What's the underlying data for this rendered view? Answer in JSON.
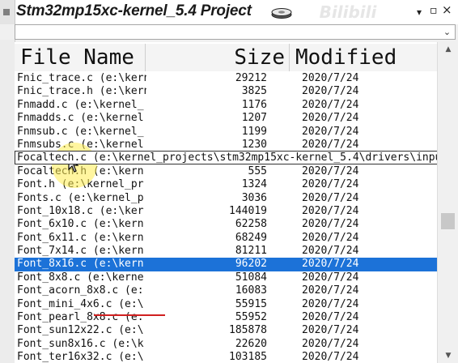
{
  "window": {
    "title": "Stm32mp15xc-kernel_5.4 Project",
    "watermark": "Bilibili"
  },
  "titlebar_icons": {
    "pin": "▾",
    "close": "×"
  },
  "combo": {
    "value": "",
    "arrow": "⌄"
  },
  "columns": {
    "name": "File Name",
    "size": "Size",
    "modified": "Modified"
  },
  "expanded_row_text": "Focaltech.c (e:\\kernel_projects\\stm32mp15xc-kernel_5.4\\drivers\\input",
  "rows": [
    {
      "name": "Fnic_trace.c (e:\\kern",
      "size": "29212",
      "modified": "2020/7/24"
    },
    {
      "name": "Fnic_trace.h (e:\\kern",
      "size": "3825",
      "modified": "2020/7/24"
    },
    {
      "name": "Fnmadd.c (e:\\kernel_",
      "size": "1176",
      "modified": "2020/7/24"
    },
    {
      "name": "Fnmadds.c (e:\\kernel",
      "size": "1207",
      "modified": "2020/7/24"
    },
    {
      "name": "Fnmsub.c (e:\\kernel_",
      "size": "1199",
      "modified": "2020/7/24"
    },
    {
      "name": "Fnmsubs.c (e:\\kernel",
      "size": "1230",
      "modified": "2020/7/24"
    },
    {
      "name": "Focaltech.c (e:\\kernel_projects\\stm32mp15xc-kernel_5.4\\drivers\\input",
      "size": "",
      "modified": ""
    },
    {
      "name": "Focaltech.h (e:\\kern",
      "size": "555",
      "modified": "2020/7/24"
    },
    {
      "name": "Font.h (e:\\kernel_pr",
      "size": "1324",
      "modified": "2020/7/24"
    },
    {
      "name": "Fonts.c (e:\\kernel_p",
      "size": "3036",
      "modified": "2020/7/24"
    },
    {
      "name": "Font_10x18.c (e:\\ker",
      "size": "144019",
      "modified": "2020/7/24"
    },
    {
      "name": "Font_6x10.c (e:\\kern",
      "size": "62258",
      "modified": "2020/7/24"
    },
    {
      "name": "Font_6x11.c (e:\\kern",
      "size": "68249",
      "modified": "2020/7/24"
    },
    {
      "name": "Font_7x14.c (e:\\kern",
      "size": "81211",
      "modified": "2020/7/24"
    },
    {
      "name": "Font_8x16.c (e:\\kern",
      "size": "96202",
      "modified": "2020/7/24"
    },
    {
      "name": "Font_8x8.c (e:\\kerne",
      "size": "51084",
      "modified": "2020/7/24"
    },
    {
      "name": "Font_acorn_8x8.c (e:",
      "size": "16083",
      "modified": "2020/7/24"
    },
    {
      "name": "Font_mini_4x6.c (e:\\",
      "size": "55915",
      "modified": "2020/7/24"
    },
    {
      "name": "Font_pearl_8x8.c (e:",
      "size": "55952",
      "modified": "2020/7/24"
    },
    {
      "name": "Font_sun12x22.c (e:\\",
      "size": "185878",
      "modified": "2020/7/24"
    },
    {
      "name": "Font_sun8x16.c (e:\\k",
      "size": "22620",
      "modified": "2020/7/24"
    },
    {
      "name": "Font_ter16x32.c (e:\\",
      "size": "103185",
      "modified": "2020/7/24"
    }
  ],
  "selected_index": 14,
  "expanded_index": 6,
  "colors": {
    "selection": "#1c72d8",
    "underline": "#d02020"
  }
}
